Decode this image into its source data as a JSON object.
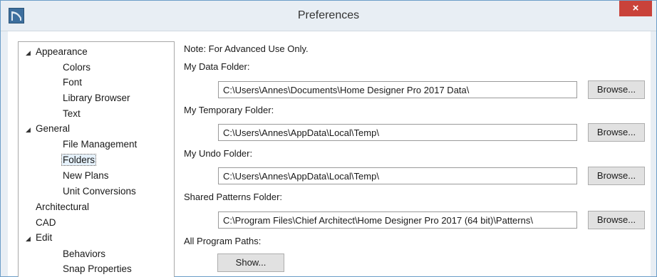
{
  "window": {
    "title": "Preferences",
    "close_label": "×"
  },
  "tree": {
    "items": [
      {
        "label": "Appearance",
        "expanded": true
      },
      {
        "label": "Colors"
      },
      {
        "label": "Font"
      },
      {
        "label": "Library Browser"
      },
      {
        "label": "Text"
      },
      {
        "label": "General",
        "expanded": true
      },
      {
        "label": "File Management"
      },
      {
        "label": "Folders",
        "selected": true
      },
      {
        "label": "New Plans"
      },
      {
        "label": "Unit Conversions"
      },
      {
        "label": "Architectural"
      },
      {
        "label": "CAD"
      },
      {
        "label": "Edit",
        "expanded": true
      },
      {
        "label": "Behaviors"
      },
      {
        "label": "Snap Properties"
      }
    ]
  },
  "folders": {
    "note": "Note: For Advanced Use Only.",
    "data_folder_label": "My Data Folder:",
    "data_folder_value": "C:\\Users\\Annes\\Documents\\Home Designer Pro 2017 Data\\",
    "temp_folder_label": "My Temporary Folder:",
    "temp_folder_value": "C:\\Users\\Annes\\AppData\\Local\\Temp\\",
    "undo_folder_label": "My Undo Folder:",
    "undo_folder_value": "C:\\Users\\Annes\\AppData\\Local\\Temp\\",
    "shared_patterns_label": "Shared Patterns Folder:",
    "shared_patterns_value": "C:\\Program Files\\Chief Architect\\Home Designer Pro 2017 (64 bit)\\Patterns\\",
    "all_paths_label": "All Program Paths:",
    "browse_label": "Browse...",
    "show_label": "Show..."
  },
  "colors": {
    "close_button": "#c9423a",
    "titlebar": "#e8eef4",
    "selection": "#e5f1fb"
  }
}
